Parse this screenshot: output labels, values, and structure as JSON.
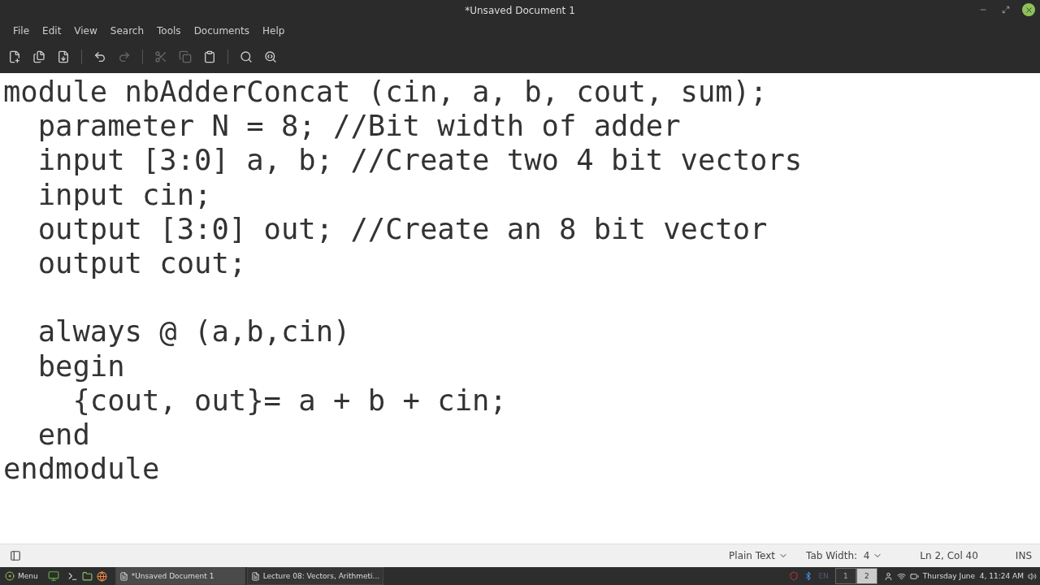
{
  "window": {
    "title": "*Unsaved Document 1"
  },
  "menu": [
    "File",
    "Edit",
    "View",
    "Search",
    "Tools",
    "Documents",
    "Help"
  ],
  "toolbar": [
    {
      "kind": "new",
      "disabled": false
    },
    {
      "kind": "open",
      "disabled": false
    },
    {
      "kind": "save",
      "disabled": false
    },
    {
      "kind": "sep"
    },
    {
      "kind": "undo",
      "disabled": false
    },
    {
      "kind": "redo",
      "disabled": true
    },
    {
      "kind": "sep"
    },
    {
      "kind": "cut",
      "disabled": true
    },
    {
      "kind": "copy",
      "disabled": true
    },
    {
      "kind": "paste",
      "disabled": false
    },
    {
      "kind": "sep"
    },
    {
      "kind": "find",
      "disabled": false
    },
    {
      "kind": "replace",
      "disabled": false
    }
  ],
  "editor": {
    "lines": [
      {
        "text": "module nbAdderConcat (cin, a, b, cout, sum);"
      },
      {
        "text": "  parameter N = 8; //Bit width of adder"
      },
      {
        "text": "  input [3:0] a, b; //Create two 4 bit vectors"
      },
      {
        "text": "  input cin;"
      },
      {
        "text": "  output [3:0] out; //Create an 8 bit vector"
      },
      {
        "text": "  output cout;"
      },
      {
        "text": "  always @ (a,b,cin)",
        "gap_before": true
      },
      {
        "text": "  begin"
      },
      {
        "text": "    {cout, out}= a + b + cin;"
      },
      {
        "text": "  end"
      },
      {
        "text": "endmodule"
      }
    ]
  },
  "status_bar": {
    "language": "Plain Text",
    "tab_width": "Tab Width:  4",
    "position": "Ln 2, Col 40",
    "mode": "INS"
  },
  "taskbar": {
    "menu": "Menu",
    "windows": [
      {
        "title": "*Unsaved Document 1",
        "selected": true
      },
      {
        "title": "Lecture 08: Vectors, Arithmeti...",
        "selected": false
      }
    ],
    "keyboard": "EN",
    "workspaces": [
      {
        "label": "1",
        "selected": false
      },
      {
        "label": "2",
        "selected": true
      }
    ],
    "clock": "Thursday June  4, 11:24 AM"
  }
}
